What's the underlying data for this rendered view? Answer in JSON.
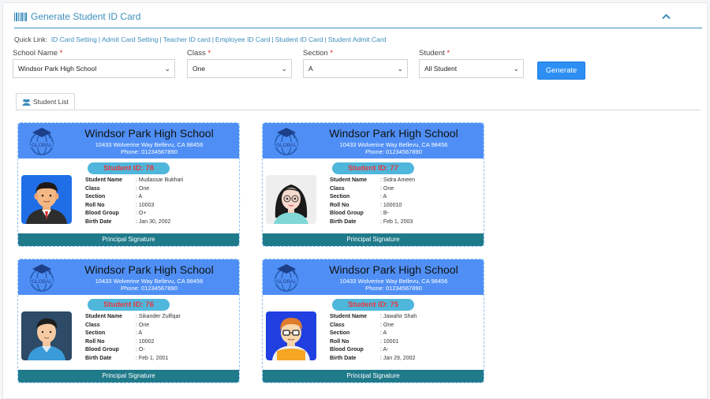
{
  "page": {
    "title": "Generate Student ID Card",
    "collapse_icon": "chevron-up-icon"
  },
  "quick_links": {
    "label": "Quick Link:",
    "items": [
      "ID Card Setting",
      "Admit Card Setting",
      "Teacher ID card",
      "Employee ID Card",
      "Student ID Card",
      "Student Admit Card"
    ]
  },
  "filters": {
    "school": {
      "label": "School Name",
      "value": "Windsor Park High School"
    },
    "class": {
      "label": "Class",
      "value": "One"
    },
    "section": {
      "label": "Section",
      "value": "A"
    },
    "student": {
      "label": "Student",
      "value": "All Student"
    },
    "required_mark": "*",
    "generate_label": "Generate"
  },
  "tab": {
    "label": "Student List",
    "icon": "users-icon"
  },
  "card_common": {
    "school_name": "Windsor Park High School",
    "address": "10433 Wolverine Way Bellevu, CA 98456",
    "phone": "Phone: 01234567890",
    "logo_text": "GLOBAL",
    "field_labels": {
      "name": "Student Name",
      "class": "Class",
      "section": "Section",
      "roll": "Roll No",
      "blood": "Blood Group",
      "birth": "Birth Date"
    },
    "footer": "Principal Signature",
    "colors": {
      "header": "#4f8ff5",
      "footer": "#1f7a8a",
      "badge": "#4fb6dc",
      "badge_text": "#e8383d"
    }
  },
  "cards": [
    {
      "id": "Student ID: 78",
      "name": ": Mudassar Bukhari",
      "class": ": One",
      "section": ": A",
      "roll": ": 10003",
      "blood": ": O+",
      "birth": ": Jan 30, 2002",
      "avatar": "male-suit-avatar"
    },
    {
      "id": "Student ID: 77",
      "name": ": Sidra Ameen",
      "class": ": One",
      "section": ": A",
      "roll": ": 100010",
      "blood": ": B-",
      "birth": ": Feb 1, 2003",
      "avatar": "female-glasses-avatar"
    },
    {
      "id": "Student ID: 76",
      "name": ": Sikander Zulfiqar",
      "class": ": One",
      "section": ": A",
      "roll": ": 10002",
      "blood": ": O-",
      "birth": ": Feb 1, 2001",
      "avatar": "male-avatar"
    },
    {
      "id": "Student ID: 75",
      "name": ": Jawahir Shah",
      "class": ": One",
      "section": ": A",
      "roll": ": 10001",
      "blood": ": A-",
      "birth": ": Jan 29, 2002",
      "avatar": "male-glasses-avatar"
    }
  ]
}
